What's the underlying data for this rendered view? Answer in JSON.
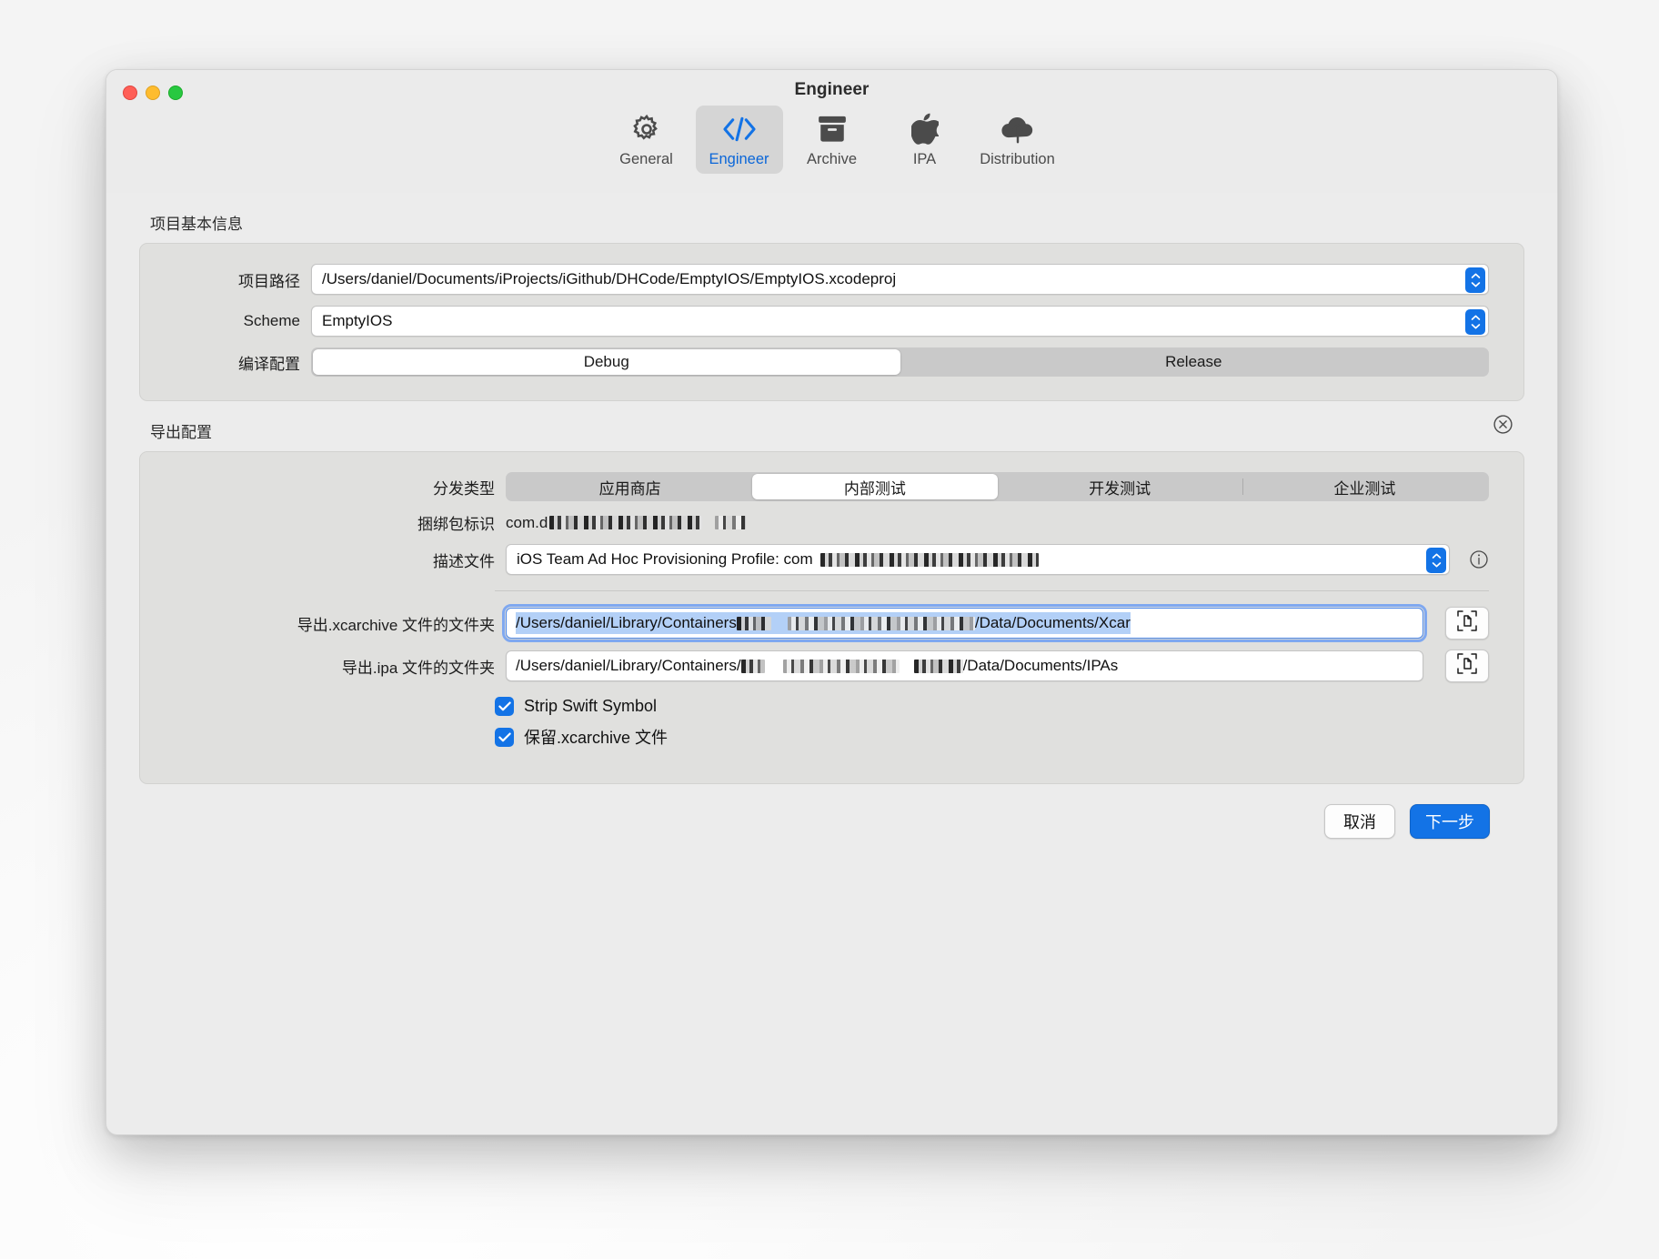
{
  "window": {
    "title": "Engineer",
    "traffic_lights": [
      "close",
      "minimize",
      "zoom"
    ]
  },
  "toolbar": {
    "items": [
      {
        "label": "General",
        "icon": "gear-icon",
        "active": false
      },
      {
        "label": "Engineer",
        "icon": "code-brackets-icon",
        "active": true
      },
      {
        "label": "Archive",
        "icon": "archivebox-icon",
        "active": false
      },
      {
        "label": "IPA",
        "icon": "apple-logo-icon",
        "active": false
      },
      {
        "label": "Distribution",
        "icon": "cloud-upload-icon",
        "active": false
      }
    ]
  },
  "project_section": {
    "title": "项目基本信息",
    "project_path": {
      "label": "项目路径",
      "value": "/Users/daniel/Documents/iProjects/iGithub/DHCode/EmptyIOS/EmptyIOS.xcodeproj"
    },
    "scheme": {
      "label": "Scheme",
      "value": "EmptyIOS"
    },
    "build_config": {
      "label": "编译配置",
      "options": [
        "Debug",
        "Release"
      ],
      "selected": "Debug"
    }
  },
  "export_section": {
    "title": "导出配置",
    "close_icon": "circle-x-icon",
    "distribution_type": {
      "label": "分发类型",
      "options": [
        "应用商店",
        "内部测试",
        "开发测试",
        "企业测试"
      ],
      "selected": "内部测试"
    },
    "bundle_id": {
      "label": "捆绑包标识",
      "value_prefix": "com.d",
      "value_redacted": true
    },
    "provisioning_profile": {
      "label": "描述文件",
      "value_prefix": "iOS Team Ad Hoc Provisioning Profile: com",
      "value_redacted": true,
      "info_icon": "info-circle-icon"
    },
    "xcarchive_folder": {
      "label": "导出.xcarchive 文件的文件夹",
      "value_prefix": "/Users/daniel/Library/Containers",
      "value_suffix": "/Data/Documents/Xcar",
      "value_redacted": true,
      "focused": true,
      "selected": true,
      "button_icon": "doc-viewfinder-icon"
    },
    "ipa_folder": {
      "label": "导出.ipa 文件的文件夹",
      "value_prefix": "/Users/daniel/Library/Containers/",
      "value_suffix": "/Data/Documents/IPAs",
      "value_redacted": true,
      "button_icon": "doc-viewfinder-icon"
    },
    "checkboxes": [
      {
        "label": "Strip Swift Symbol",
        "checked": true
      },
      {
        "label": "保留.xcarchive 文件",
        "checked": true
      }
    ]
  },
  "footer": {
    "cancel_label": "取消",
    "next_label": "下一步"
  },
  "colors": {
    "accent_blue": "#1373e6",
    "tab_active_text": "#0a66d8",
    "window_bg": "#ececec",
    "panel_bg": "#e0e0de",
    "selection_blue": "#b3d0f7"
  }
}
